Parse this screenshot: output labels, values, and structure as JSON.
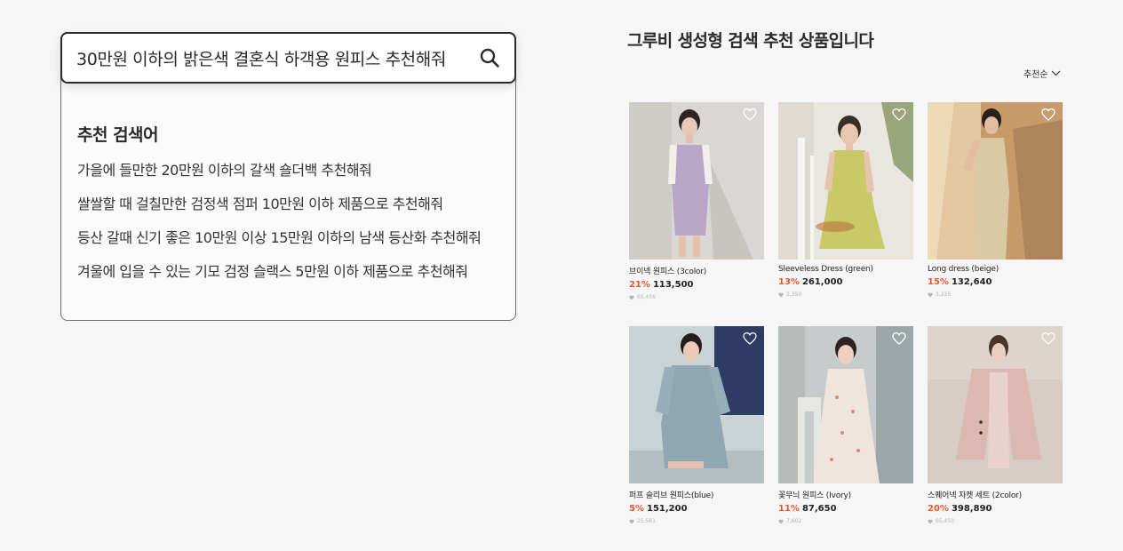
{
  "search": {
    "query": "30만원 이하의 밝은색 결혼식 하객용 원피스 추천해줘"
  },
  "suggestions": {
    "title": "추천 검색어",
    "items": [
      "가을에 들만한 20만원 이하의 갈색 숄더백 추천해줘",
      "쌀쌀할 때 걸칠만한 검정색 점퍼 10만원 이하 제품으로 추천해줘",
      "등산 갈때 신기 좋은 10만원 이상 15만원 이하의 남색 등산화 추천해줘",
      "겨울에 입을 수 있는 기모 검정 슬랙스 5만원 이하 제품으로 추천해줘"
    ]
  },
  "results": {
    "title": "그루비 생성형 검색 추천 상품입니다",
    "sort_label": "추천순",
    "products": [
      {
        "name": "브이넥 원피스 (3color)",
        "discount": "21%",
        "price": "113,500",
        "likes": "65,456"
      },
      {
        "name": "Sleeveless Dress (green)",
        "discount": "13%",
        "price": "261,000",
        "likes": "2,350"
      },
      {
        "name": "Long dress (beige)",
        "discount": "15%",
        "price": "132,640",
        "likes": "3,235"
      },
      {
        "name": "퍼프 슬리브 원피스(blue)",
        "discount": "5%",
        "price": "151,200",
        "likes": "25,561"
      },
      {
        "name": "꽃무늬 원피스 (Ivory)",
        "discount": "11%",
        "price": "87,650",
        "likes": "7,602"
      },
      {
        "name": "스퀘어넥 자켓 세트 (2color)",
        "discount": "20%",
        "price": "398,890",
        "likes": "65,450"
      }
    ]
  },
  "colors": {
    "accent_discount": "#e8572a",
    "background": "#f6f6f6"
  }
}
